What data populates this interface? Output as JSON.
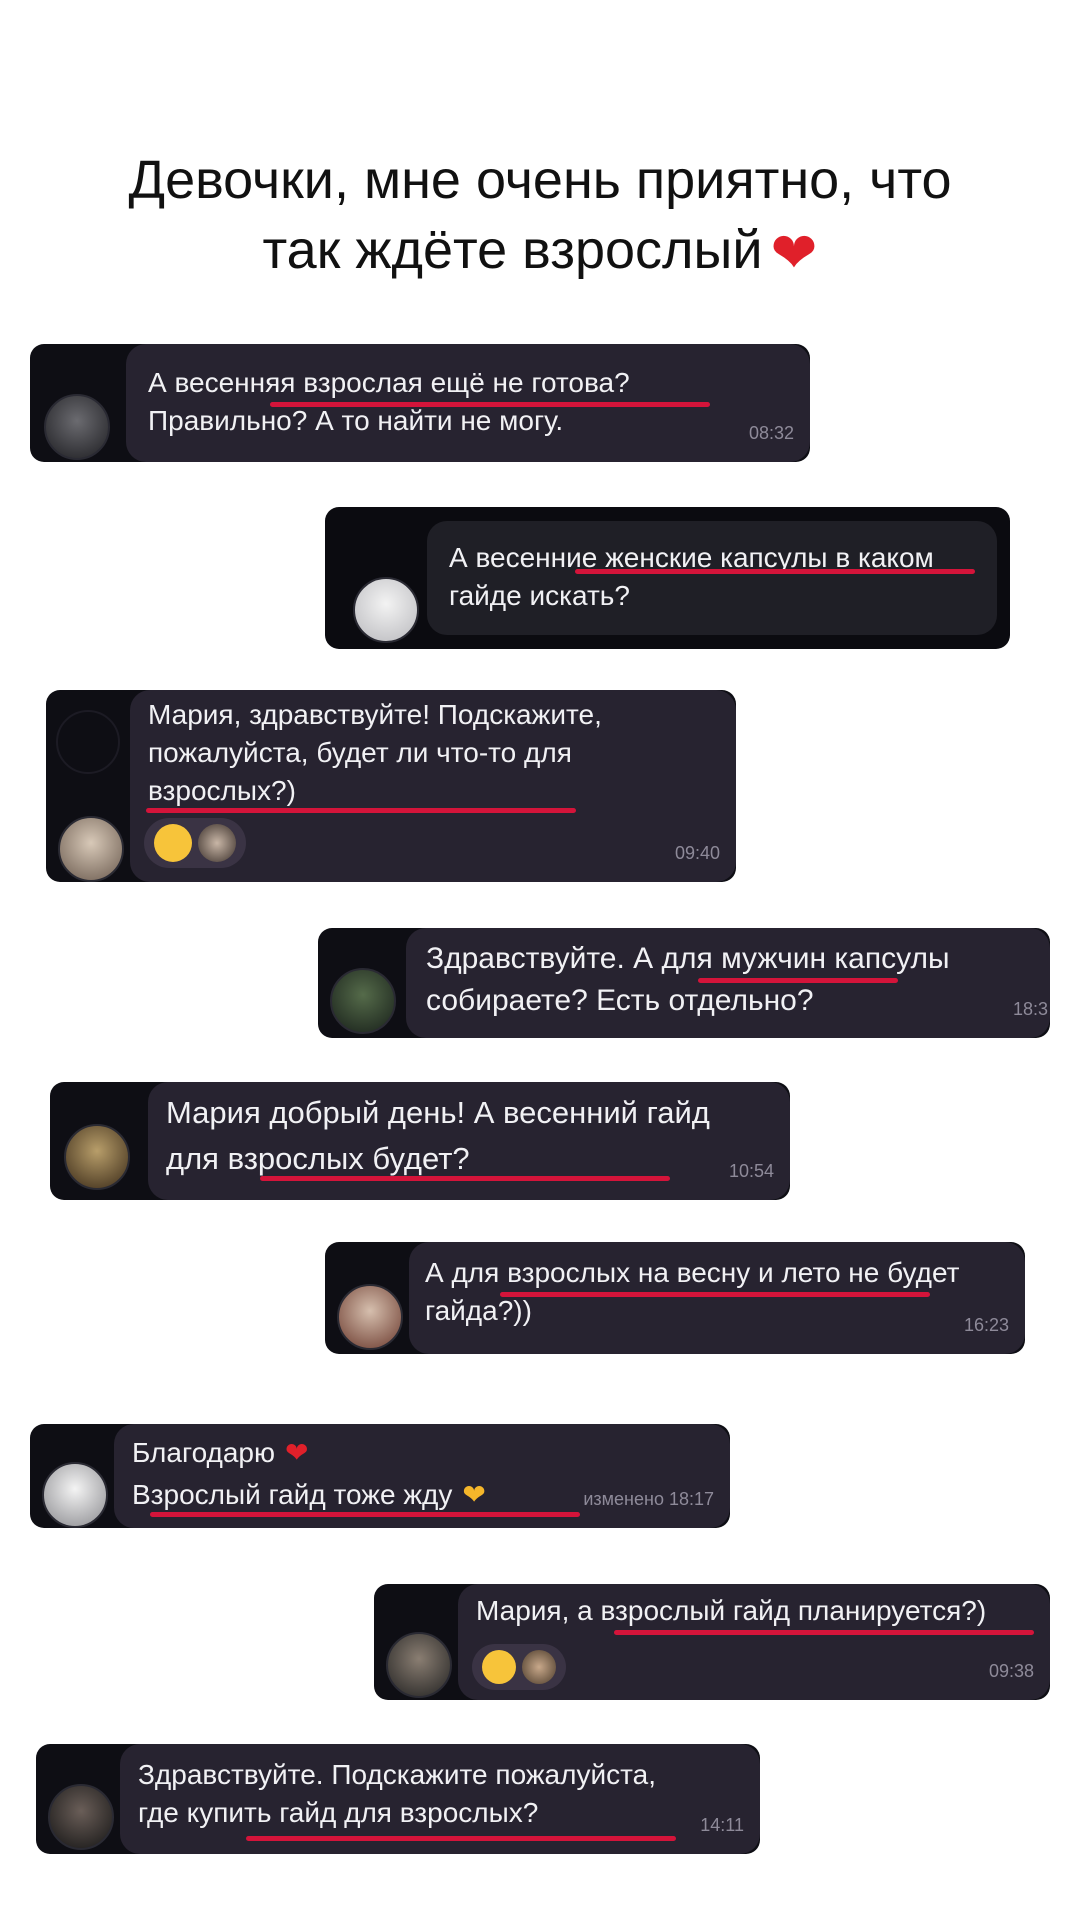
{
  "headline": {
    "line1": "Девочки, мне очень приятно, что",
    "line2": "так ждёте взрослый"
  },
  "colors": {
    "bubble": "#272330",
    "underline": "#d4143a",
    "heart": "#e0202a"
  },
  "messages": [
    {
      "text": "А весенняя взрослая ещё не готова?\nПравильно? А то найти не могу.",
      "time": "08:32"
    },
    {
      "text": "А весенние женские капсулы в каком\nгайде искать?",
      "time": ""
    },
    {
      "text": "Мария, здравствуйте! Подскажите,\nпожалуйста, будет ли что-то для\nвзрослых?)",
      "time": "09:40",
      "reactions": [
        "kissing-face-emoji",
        "photo-avatar"
      ]
    },
    {
      "text": "Здравствуйте. А для мужчин капсулы\nсобираете? Есть отдельно?",
      "time": "18:3"
    },
    {
      "text": "Мария добрый день! А весенний гайд\nдля взрослых будет?",
      "time": "10:54"
    },
    {
      "text": "А для взрослых на весну и лето не будет\nгайда?))",
      "time": "16:23"
    },
    {
      "text": "Благодарю",
      "text2": "Взрослый гайд тоже жду",
      "time": "изменено 18:17"
    },
    {
      "text": "Мария, а взрослый гайд планируется?)",
      "time": "09:38",
      "reactions": [
        "sunglasses-face-emoji",
        "photo-avatar"
      ]
    },
    {
      "text": "Здравствуйте. Подскажите пожалуйста,\nгде купить гайд для взрослых?",
      "time": "14:11"
    }
  ]
}
